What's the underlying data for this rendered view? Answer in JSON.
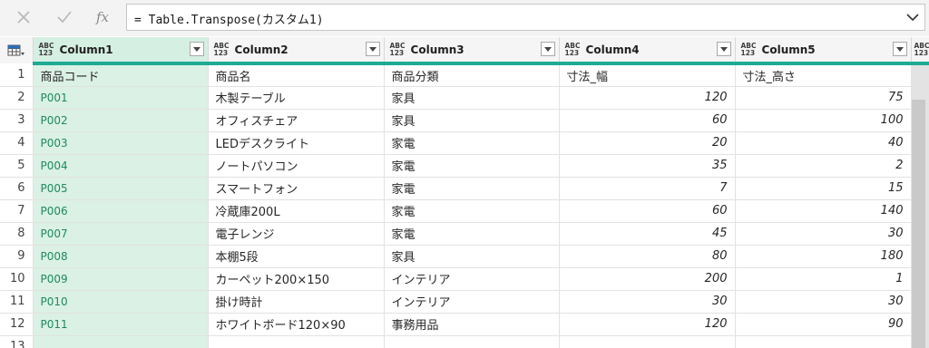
{
  "formula_bar": {
    "cancel_icon": "close-icon",
    "confirm_icon": "check-icon",
    "fx_label": "fx",
    "formula": "= Table.Transpose(カスタム1)"
  },
  "table": {
    "type_icon_top": "ABC",
    "type_icon_bottom": "123",
    "columns": [
      "Column1",
      "Column2",
      "Column3",
      "Column4",
      "Column5"
    ],
    "rows": [
      {
        "n": "1",
        "c1": "商品コード",
        "c2": "商品名",
        "c3": "商品分類",
        "c4": "寸法_幅",
        "c5": "寸法_高さ"
      },
      {
        "n": "2",
        "c1": "P001",
        "c2": "木製テーブル",
        "c3": "家具",
        "c4": "120",
        "c5": "75"
      },
      {
        "n": "3",
        "c1": "P002",
        "c2": "オフィスチェア",
        "c3": "家具",
        "c4": "60",
        "c5": "100"
      },
      {
        "n": "4",
        "c1": "P003",
        "c2": "LEDデスクライト",
        "c3": "家電",
        "c4": "20",
        "c5": "40"
      },
      {
        "n": "5",
        "c1": "P004",
        "c2": "ノートパソコン",
        "c3": "家電",
        "c4": "35",
        "c5": "2"
      },
      {
        "n": "6",
        "c1": "P005",
        "c2": "スマートフォン",
        "c3": "家電",
        "c4": "7",
        "c5": "15"
      },
      {
        "n": "7",
        "c1": "P006",
        "c2": "冷蔵庫200L",
        "c3": "家電",
        "c4": "60",
        "c5": "140"
      },
      {
        "n": "8",
        "c1": "P007",
        "c2": "電子レンジ",
        "c3": "家電",
        "c4": "45",
        "c5": "30"
      },
      {
        "n": "9",
        "c1": "P008",
        "c2": "本棚5段",
        "c3": "家具",
        "c4": "80",
        "c5": "180"
      },
      {
        "n": "10",
        "c1": "P009",
        "c2": "カーペット200×150",
        "c3": "インテリア",
        "c4": "200",
        "c5": "1"
      },
      {
        "n": "11",
        "c1": "P010",
        "c2": "掛け時計",
        "c3": "インテリア",
        "c4": "30",
        "c5": "30"
      },
      {
        "n": "12",
        "c1": "P011",
        "c2": "ホワイトボード120×90",
        "c3": "事務用品",
        "c4": "120",
        "c5": "90"
      },
      {
        "n": "13",
        "c1": "",
        "c2": "",
        "c3": "",
        "c4": "",
        "c5": ""
      }
    ]
  },
  "colors": {
    "accent": "#1fab93",
    "selected_column": "#dbf1e6",
    "code_text": "#1f8a5c"
  }
}
